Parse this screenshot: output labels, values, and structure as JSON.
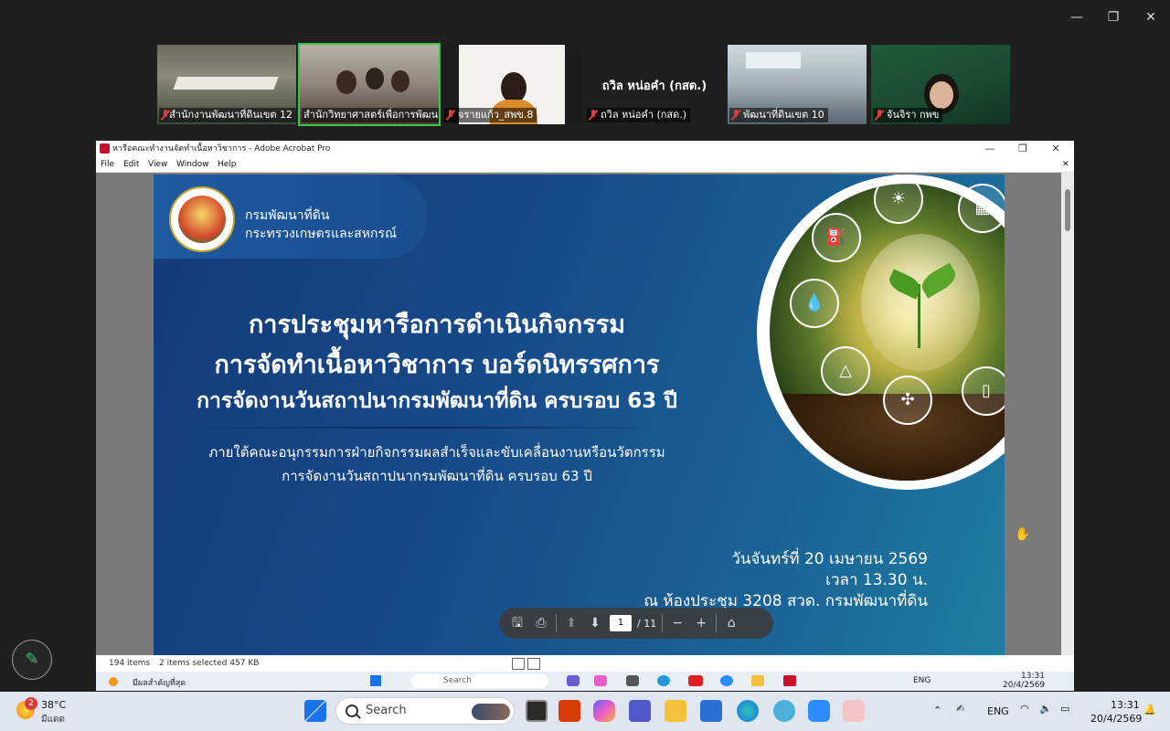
{
  "zoom": {
    "window_controls": {
      "minimize": "—",
      "restore": "❐",
      "close": "✕"
    },
    "participants": [
      {
        "name": "สำนักงานพัฒนาที่ดินเขต 12",
        "muted": true,
        "active": false,
        "video": true
      },
      {
        "name": "สำนักวิทยาศาสตร์เพื่อการพัฒนา...",
        "muted": false,
        "active": true,
        "video": true
      },
      {
        "name": "จรายแก้ว_สพข.8",
        "muted": true,
        "active": false,
        "video": true
      },
      {
        "name": "ถวิล หน่อคำ (กสด.)",
        "muted": true,
        "active": false,
        "video": false,
        "center_label": "ถวิล หน่อคำ (กสด.)"
      },
      {
        "name": "พัฒนาที่ดินเขต 10",
        "muted": true,
        "active": false,
        "video": true
      },
      {
        "name": "จันจิรา กพข",
        "muted": true,
        "active": false,
        "video": true
      }
    ]
  },
  "acrobat": {
    "title": "หารือคณะทำงานจัดทำเนื้อหาวิชาการ - Adobe Acrobat Pro",
    "menu": [
      "File",
      "Edit",
      "View",
      "Window",
      "Help"
    ],
    "page_current": "1",
    "page_total": "/ 11",
    "slide": {
      "org_line1": "กรมพัฒนาที่ดิน",
      "org_line2": "กระทรวงเกษตรและสหกรณ์",
      "headline1": "การประชุมหารือการดำเนินกิจกรรม",
      "headline2": "การจัดทำเนื้อหาวิชาการ บอร์ดนิทรรศการ",
      "headline3": "การจัดงานวันสถาปนากรมพัฒนาที่ดิน ครบรอบ 63 ปี",
      "sub1": "ภายใต้คณะอนุกรรมการฝ่ายกิจกรรมผลสำเร็จและขับเคลื่อนงานหรือนวัตกรรม",
      "sub2": "การจัดงานวันสถาปนากรมพัฒนาที่ดิน ครบรอบ 63 ปี",
      "date": "วันจันทร์ที่ 20 เมษายน 2569",
      "time": "เวลา 13.30 น.",
      "place": "ณ ห้องประชุม 3208 สวด. กรมพัฒนาที่ดิน"
    },
    "status": {
      "items": "194 items",
      "selected": "2 items selected  457 KB"
    },
    "inner_taskbar": {
      "weather_note": "มีผลสำคัญที่สุด",
      "search": "Search",
      "lang": "ENG",
      "time": "13:31",
      "date": "20/4/2569"
    }
  },
  "taskbar": {
    "weather_temp": "38°C",
    "weather_desc": "มีแดด",
    "weather_badge": "2",
    "search_placeholder": "Search",
    "lang": "ENG",
    "time": "13:31",
    "date": "20/4/2569"
  },
  "colors": {
    "zoom_bg": "#1f1f1f",
    "active_speaker": "#37c84a",
    "slide_blue": "#174a8a",
    "taskbar": "#dfe6f0"
  }
}
